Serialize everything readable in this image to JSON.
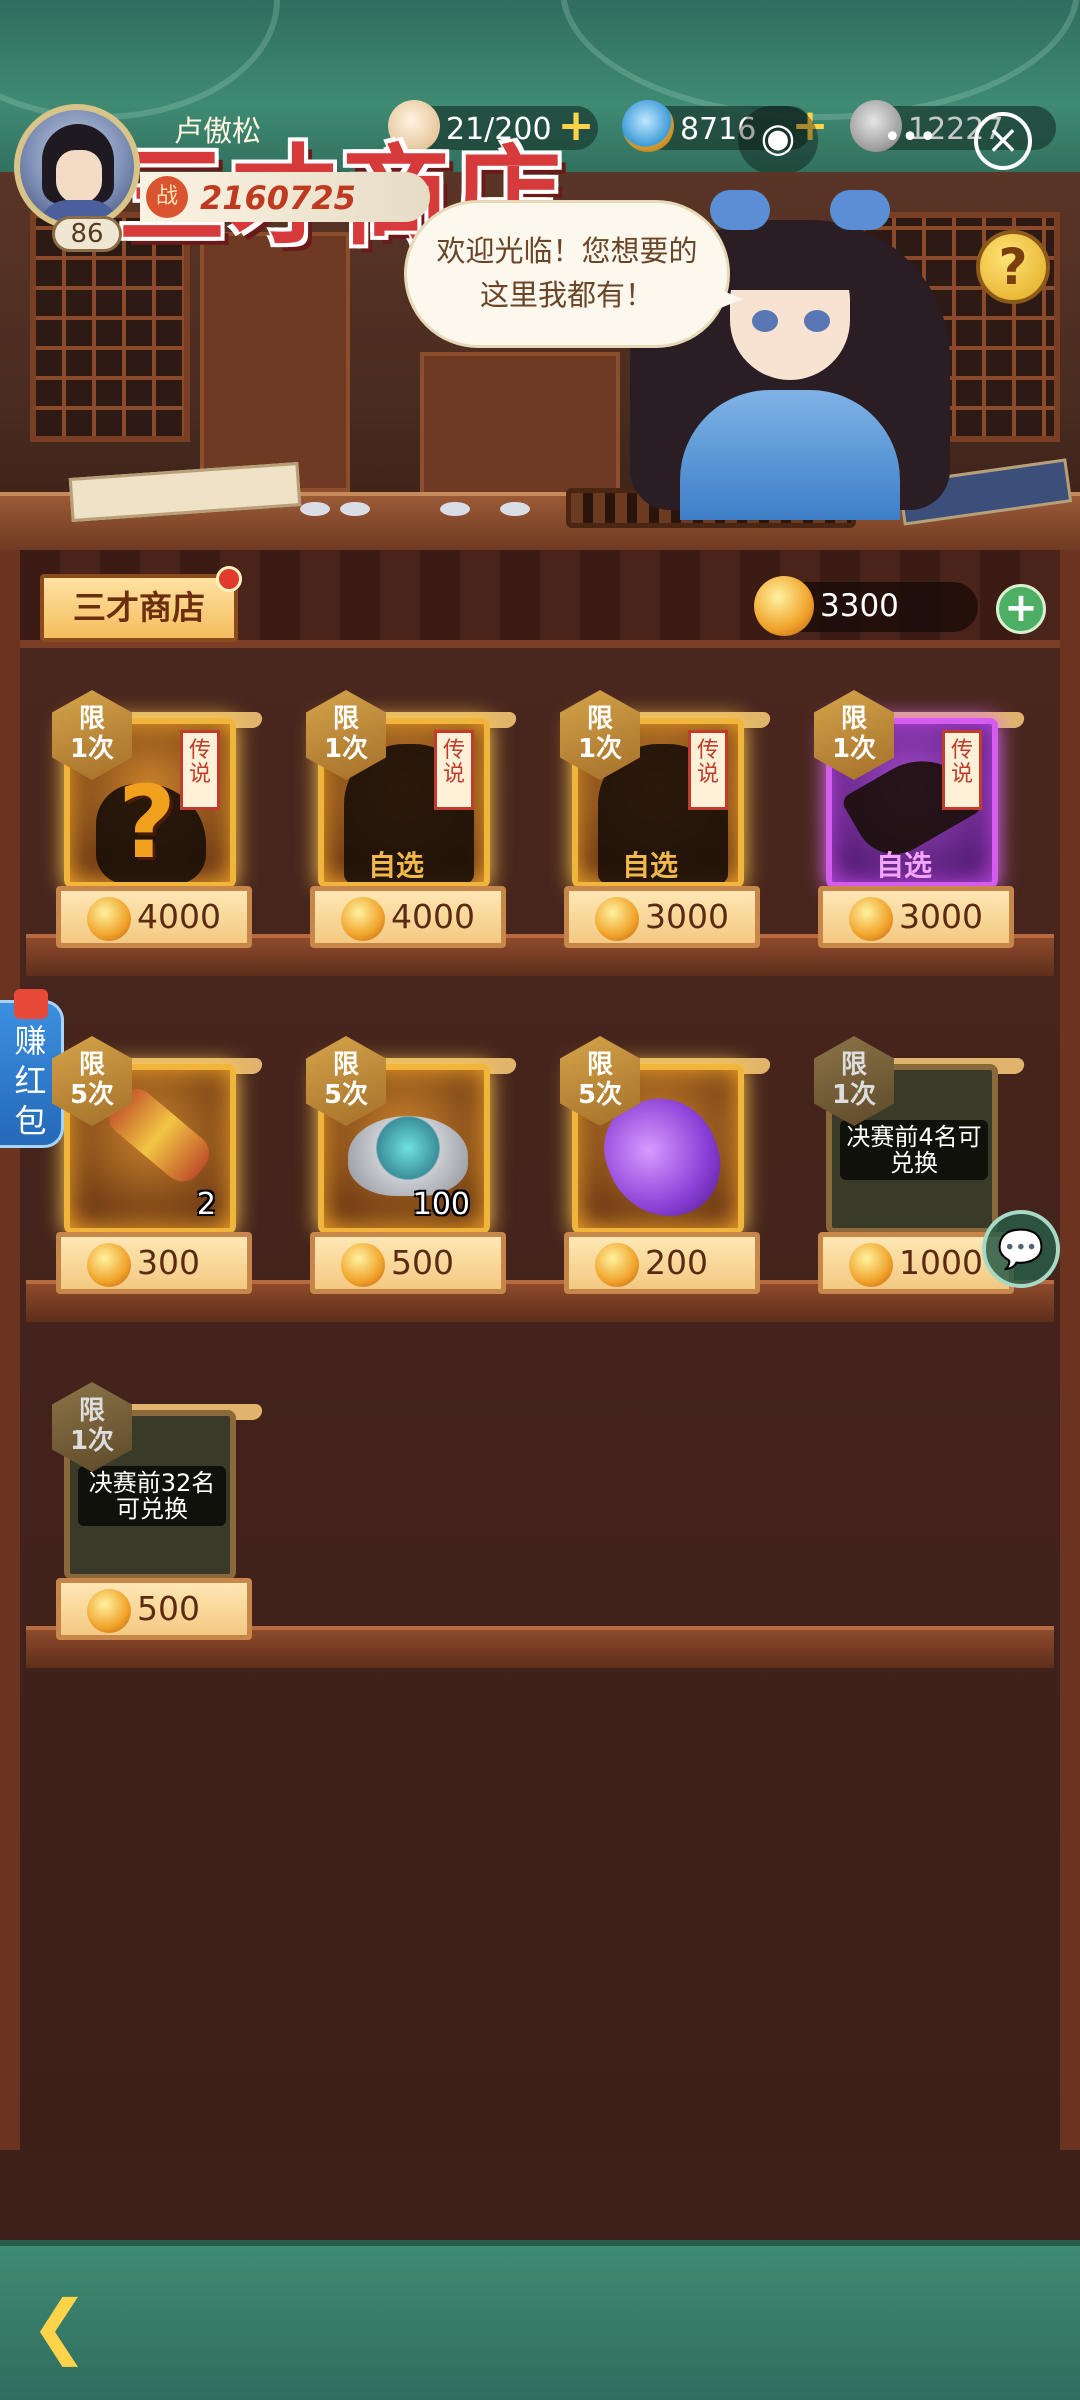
{
  "header": {
    "player_name": "卢傲松",
    "level": "86",
    "power_icon": "战",
    "power": "2160725",
    "stamina": "21/200",
    "jade": "8716",
    "coins": "12227"
  },
  "banner": {
    "title": "三才商店",
    "speech_line1": "欢迎光临！您想要的",
    "speech_line2": "这里我都有！",
    "help_label": "?"
  },
  "shop": {
    "tab_label": "三才商店",
    "currency_amount": "3300"
  },
  "items": [
    {
      "limit_line1": "限",
      "limit_line2": "1次",
      "tag": "传说",
      "overlay": "",
      "qty": "",
      "price": "4000"
    },
    {
      "limit_line1": "限",
      "limit_line2": "1次",
      "tag": "传说",
      "overlay": "自选",
      "qty": "",
      "price": "4000"
    },
    {
      "limit_line1": "限",
      "limit_line2": "1次",
      "tag": "传说",
      "overlay": "自选",
      "qty": "",
      "price": "3000"
    },
    {
      "limit_line1": "限",
      "limit_line2": "1次",
      "tag": "传说",
      "overlay": "自选",
      "qty": "",
      "price": "3000"
    },
    {
      "limit_line1": "限",
      "limit_line2": "5次",
      "tag": "",
      "overlay": "",
      "qty": "2",
      "price": "300"
    },
    {
      "limit_line1": "限",
      "limit_line2": "5次",
      "tag": "",
      "overlay": "",
      "qty": "100",
      "price": "500"
    },
    {
      "limit_line1": "限",
      "limit_line2": "5次",
      "tag": "",
      "overlay": "",
      "qty": "",
      "price": "200"
    },
    {
      "limit_line1": "限",
      "limit_line2": "1次",
      "tag": "",
      "overlay": "决赛前4名可兑换",
      "qty": "",
      "price": "1000"
    },
    {
      "limit_line1": "限",
      "limit_line2": "1次",
      "tag": "",
      "overlay": "决赛前32名可兑换",
      "qty": "",
      "price": "500"
    }
  ],
  "side": {
    "red_envelope": "赚红包"
  },
  "icons": {
    "stamina": "bun-icon",
    "jade": "jade-icon",
    "coins": "copper-coin-icon",
    "gamepad": "gamepad-icon",
    "close": "close-icon",
    "chat": "chat-icon",
    "back": "back-arrow-icon"
  }
}
